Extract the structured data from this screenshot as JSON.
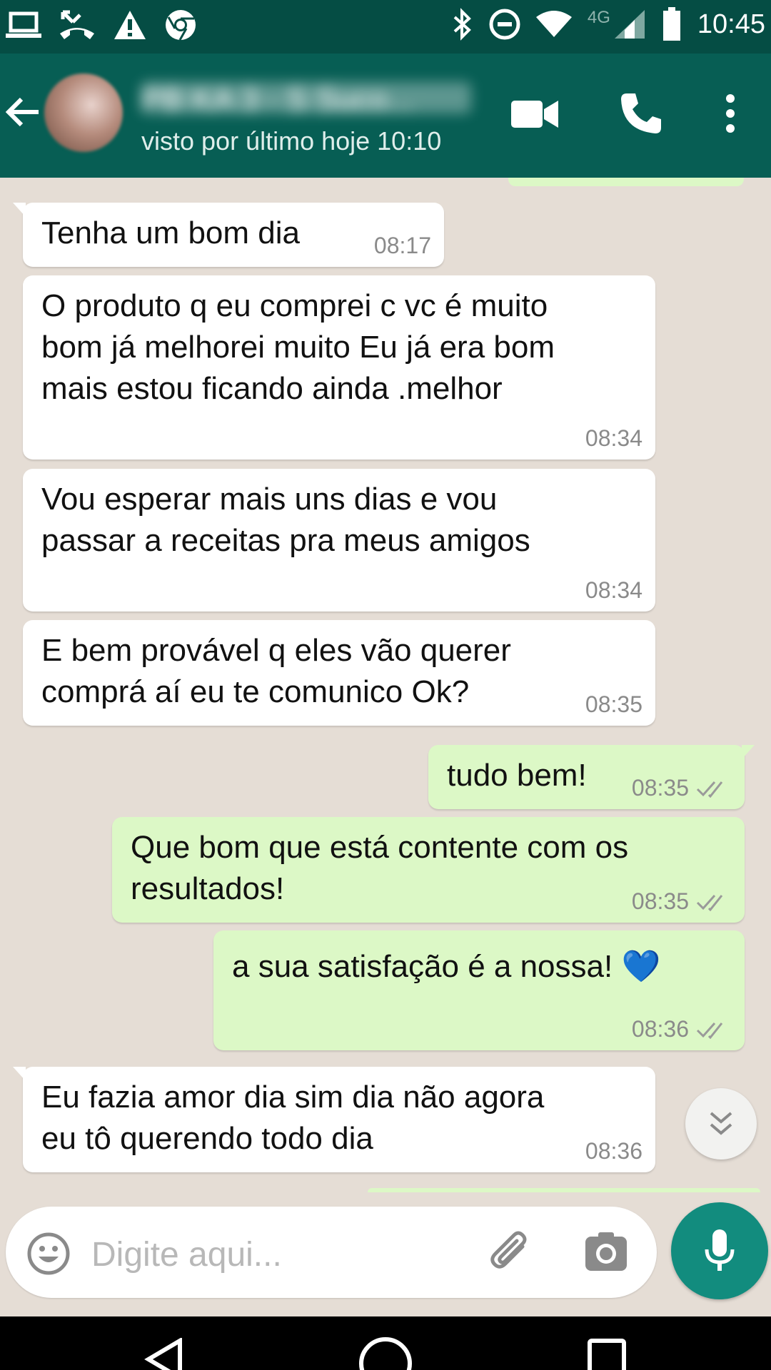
{
  "status_bar": {
    "time": "10:45",
    "network": "4G",
    "left_icons": [
      "laptop-icon",
      "missed-call-icon",
      "warning-icon",
      "chrome-icon"
    ],
    "right_icons": [
      "bluetooth-icon",
      "dnd-icon",
      "wifi-icon",
      "signal-icon",
      "battery-icon"
    ]
  },
  "header": {
    "contact_name": "PB KA 3 - S Suco...",
    "last_seen": "visto por último hoje 10:10"
  },
  "messages": [
    {
      "dir": "in",
      "text": "Tenha um bom dia",
      "time": "08:17"
    },
    {
      "dir": "in",
      "text": "O produto  q eu comprei  c vc é muito\nbom já melhorei muito Eu já era bom\nmais estou ficando  ainda  .melhor",
      "time": "08:34"
    },
    {
      "dir": "in",
      "text": "Vou esperar  mais uns dias e vou\npassar  a receitas pra  meus amigos",
      "time": "08:34"
    },
    {
      "dir": "in",
      "text": "E bem provável  q eles vão  querer\ncomprá  aí eu te comunico Ok?",
      "time": "08:35"
    },
    {
      "dir": "out",
      "text": "tudo bem!",
      "time": "08:35",
      "status": "read"
    },
    {
      "dir": "out",
      "text": "Que bom que está contente com os\nresultados!",
      "time": "08:35",
      "status": "read"
    },
    {
      "dir": "out",
      "text": "a sua satisfação é a nossa! 💙",
      "time": "08:36",
      "status": "read"
    },
    {
      "dir": "in",
      "text": "Eu fazia  amor dia sim dia não agora\neu tô querendo  todo dia",
      "time": "08:36"
    }
  ],
  "composer": {
    "placeholder": "Digite aqui..."
  },
  "colors": {
    "header": "#075e54",
    "status_bar": "#054d44",
    "incoming_bubble": "#ffffff",
    "outgoing_bubble": "#dcf8c6",
    "accent": "#128c7e",
    "read_ticks": "#9a9a9a"
  }
}
